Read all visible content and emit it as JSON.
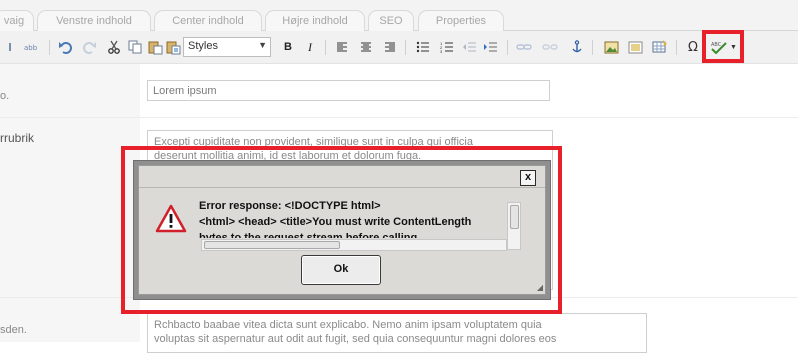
{
  "tabs": [
    {
      "label": "vaig"
    },
    {
      "label": "Venstre indhold"
    },
    {
      "label": "Center indhold"
    },
    {
      "label": "Højre indhold"
    },
    {
      "label": "SEO"
    },
    {
      "label": "Properties"
    }
  ],
  "toolbar": {
    "styles_value": "Styles",
    "bold_label": "B",
    "italic_label": "I",
    "omega_label": "Ω",
    "highlight_color": "#e8202a"
  },
  "form": {
    "row1_label": "o.",
    "title_value": "Lorem ipsum",
    "row2_label": "rrubrik",
    "content_line1": "Excepti cupiditate non provident, similique sunt in culpa qui officia",
    "content_line2": "deserunt mollitia animi, id est laborum et dolorum fuga.",
    "row3_label": "sden.",
    "text_line1": "Rchbacto baabae vitea dicta sunt explicabo. Nemo anim ipsam voluptatem quia",
    "text_line2": "voluptas sit aspernatur aut odit aut fugit, sed quia consequuntur magni dolores eos"
  },
  "dialog": {
    "line1": "Error response: <!DOCTYPE html>",
    "line2": "<html> <head> <title>You must write ContentLength",
    "line3": "bytes to the request stream before calling",
    "ok_label": "Ok",
    "close_label": "x",
    "highlight_color": "#e8202a"
  }
}
